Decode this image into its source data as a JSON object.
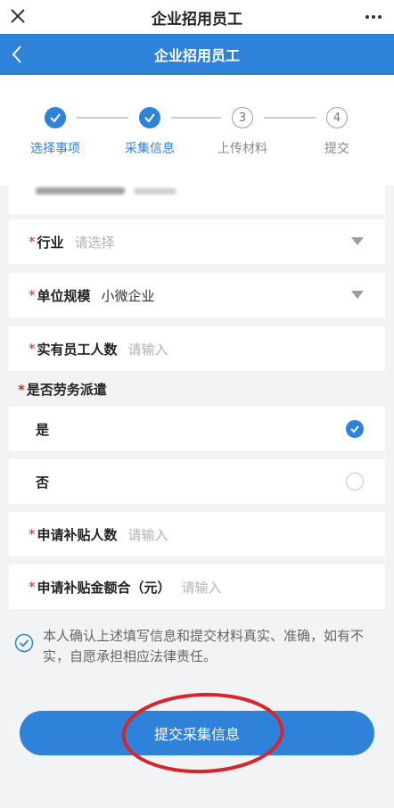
{
  "top_bar": {
    "title": "企业招用员工",
    "close_icon": "close-icon",
    "more_icon": "more-icon"
  },
  "nav_bar": {
    "title": "企业招用员工",
    "back_icon": "chevron-left-icon"
  },
  "steps": [
    {
      "label": "选择事项",
      "status": "done"
    },
    {
      "label": "采集信息",
      "status": "done"
    },
    {
      "label": "上传材料",
      "status": "todo",
      "number": "3"
    },
    {
      "label": "提交",
      "status": "todo",
      "number": "4"
    }
  ],
  "form": {
    "industry": {
      "required": "*",
      "label": "行业",
      "placeholder": "请选择"
    },
    "unit_size": {
      "required": "*",
      "label": "单位规模",
      "value": "小微企业"
    },
    "employee_count": {
      "required": "*",
      "label": "实有员工人数",
      "placeholder": "请输入"
    },
    "labor_dispatch": {
      "required": "*",
      "label": "是否劳务派遣",
      "options": [
        {
          "label": "是",
          "selected": true
        },
        {
          "label": "否",
          "selected": false
        }
      ]
    },
    "subsidy_count": {
      "required": "*",
      "label": "申请补贴人数",
      "placeholder": "请输入"
    },
    "subsidy_amount": {
      "required": "*",
      "label": "申请补贴金额合（元）",
      "placeholder": "请输入"
    }
  },
  "confirm": {
    "checked": true,
    "text": "本人确认上述填写信息和提交材料真实、准确，如有不实，自愿承担相应法律责任。"
  },
  "submit_button": {
    "label": "提交采集信息"
  },
  "colors": {
    "primary": "#2f82d9",
    "required": "#e02020",
    "annotation": "#d6262c",
    "background": "#f2f3f5"
  }
}
